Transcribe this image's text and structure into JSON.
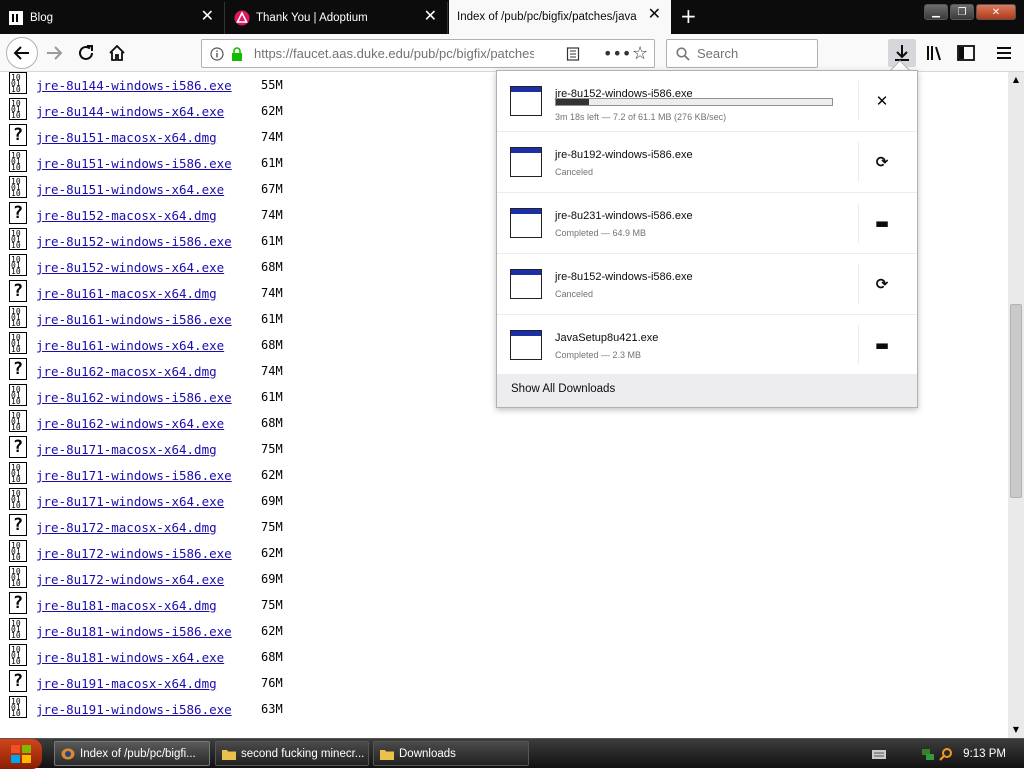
{
  "tabs": [
    {
      "title": "Blog",
      "icon": "blog-icon"
    },
    {
      "title": "Thank You | Adoptium",
      "icon": "adoptium-icon"
    },
    {
      "title": "Index of /pub/pc/bigfix/patches/java",
      "icon": "none",
      "active": true
    }
  ],
  "navbar": {
    "url": "https://faucet.aas.duke.edu/pub/pc/bigfix/patches/java/",
    "search_placeholder": "Search"
  },
  "listing": [
    {
      "name": "jre-8u144-windows-i586.exe",
      "size": "55M",
      "type": "binary"
    },
    {
      "name": "jre-8u144-windows-x64.exe",
      "size": "62M",
      "type": "binary"
    },
    {
      "name": "jre-8u151-macosx-x64.dmg",
      "size": "74M",
      "type": "unknown"
    },
    {
      "name": "jre-8u151-windows-i586.exe",
      "size": "61M",
      "type": "binary"
    },
    {
      "name": "jre-8u151-windows-x64.exe",
      "size": "67M",
      "type": "binary"
    },
    {
      "name": "jre-8u152-macosx-x64.dmg",
      "size": "74M",
      "type": "unknown"
    },
    {
      "name": "jre-8u152-windows-i586.exe",
      "size": "61M",
      "type": "binary"
    },
    {
      "name": "jre-8u152-windows-x64.exe",
      "size": "68M",
      "type": "binary"
    },
    {
      "name": "jre-8u161-macosx-x64.dmg",
      "size": "74M",
      "type": "unknown"
    },
    {
      "name": "jre-8u161-windows-i586.exe",
      "size": "61M",
      "type": "binary"
    },
    {
      "name": "jre-8u161-windows-x64.exe",
      "size": "68M",
      "type": "binary"
    },
    {
      "name": "jre-8u162-macosx-x64.dmg",
      "size": "74M",
      "type": "unknown"
    },
    {
      "name": "jre-8u162-windows-i586.exe",
      "size": "61M",
      "type": "binary"
    },
    {
      "name": "jre-8u162-windows-x64.exe",
      "size": "68M",
      "type": "binary"
    },
    {
      "name": "jre-8u171-macosx-x64.dmg",
      "size": "75M",
      "type": "unknown"
    },
    {
      "name": "jre-8u171-windows-i586.exe",
      "size": "62M",
      "type": "binary"
    },
    {
      "name": "jre-8u171-windows-x64.exe",
      "size": "69M",
      "type": "binary"
    },
    {
      "name": "jre-8u172-macosx-x64.dmg",
      "size": "75M",
      "type": "unknown"
    },
    {
      "name": "jre-8u172-windows-i586.exe",
      "size": "62M",
      "type": "binary"
    },
    {
      "name": "jre-8u172-windows-x64.exe",
      "size": "69M",
      "type": "binary"
    },
    {
      "name": "jre-8u181-macosx-x64.dmg",
      "size": "75M",
      "type": "unknown"
    },
    {
      "name": "jre-8u181-windows-i586.exe",
      "size": "62M",
      "type": "binary"
    },
    {
      "name": "jre-8u181-windows-x64.exe",
      "size": "68M",
      "type": "binary"
    },
    {
      "name": "jre-8u191-macosx-x64.dmg",
      "size": "76M",
      "type": "unknown"
    },
    {
      "name": "jre-8u191-windows-i586.exe",
      "size": "63M",
      "type": "binary"
    }
  ],
  "downloads": {
    "items": [
      {
        "name": "jre-8u152-windows-i586.exe",
        "status": "3m 18s left — 7.2 of 61.1 MB (276 KB/sec)",
        "progress": 0.118,
        "action": "cancel-icon",
        "action_glyph": "✕"
      },
      {
        "name": "jre-8u192-windows-i586.exe",
        "status": "Canceled",
        "action": "retry-icon",
        "action_glyph": "⟳"
      },
      {
        "name": "jre-8u231-windows-i586.exe",
        "status": "Completed — 64.9 MB",
        "action": "folder-icon",
        "action_glyph": "▬"
      },
      {
        "name": "jre-8u152-windows-i586.exe",
        "status": "Canceled",
        "action": "retry-icon",
        "action_glyph": "⟳"
      },
      {
        "name": "JavaSetup8u421.exe",
        "status": "Completed — 2.3 MB",
        "action": "folder-icon",
        "action_glyph": "▬"
      }
    ],
    "show_all": "Show All Downloads"
  },
  "taskbar": {
    "tasks": [
      {
        "label": "Index of /pub/pc/bigfi...",
        "active": true
      },
      {
        "label": "second fucking minecr..."
      },
      {
        "label": "Downloads"
      }
    ],
    "clock": "9:13 PM"
  }
}
